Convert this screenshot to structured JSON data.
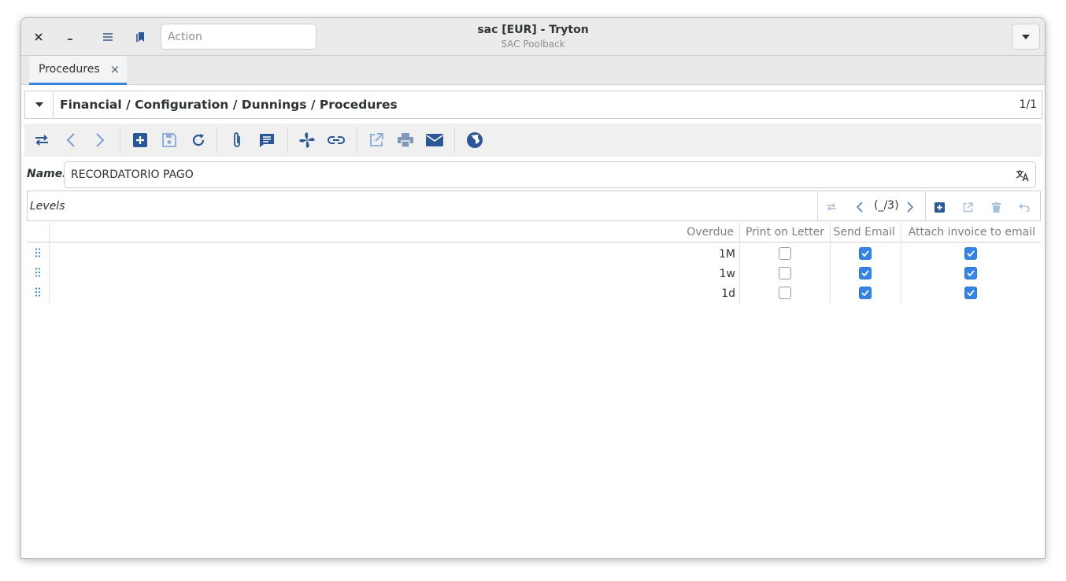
{
  "window": {
    "title": "sac [EUR] - Tryton",
    "subtitle": "SAC Poolback",
    "action_placeholder": "Action"
  },
  "tabs": [
    {
      "label": "Procedures",
      "close": "×"
    }
  ],
  "breadcrumb": {
    "path": "Financial / Configuration / Dunnings / Procedures",
    "count": "1/1"
  },
  "toolbar_icons": [
    "switch-view-icon",
    "previous-icon",
    "next-icon",
    "new-icon",
    "save-icon",
    "reload-icon",
    "attachment-icon",
    "notes-icon",
    "action-icon",
    "relate-icon",
    "open-external-icon",
    "print-icon",
    "email-icon",
    "web-icon"
  ],
  "form": {
    "name_label": "Name:",
    "name_value": "RECORDATORIO PAGO"
  },
  "levels": {
    "label": "Levels",
    "position": "(_/3)",
    "columns": [
      "Overdue",
      "Print on Letter",
      "Send Email",
      "Attach invoice to email"
    ],
    "rows": [
      {
        "overdue": "1M",
        "print_on_letter": false,
        "send_email": true,
        "attach_invoice": true
      },
      {
        "overdue": "1w",
        "print_on_letter": false,
        "send_email": true,
        "attach_invoice": true
      },
      {
        "overdue": "1d",
        "print_on_letter": false,
        "send_email": true,
        "attach_invoice": true
      }
    ]
  },
  "colors": {
    "accent": "#3584e4",
    "icon_blue": "#2b5797",
    "icon_disabled": "#9db4d3"
  }
}
